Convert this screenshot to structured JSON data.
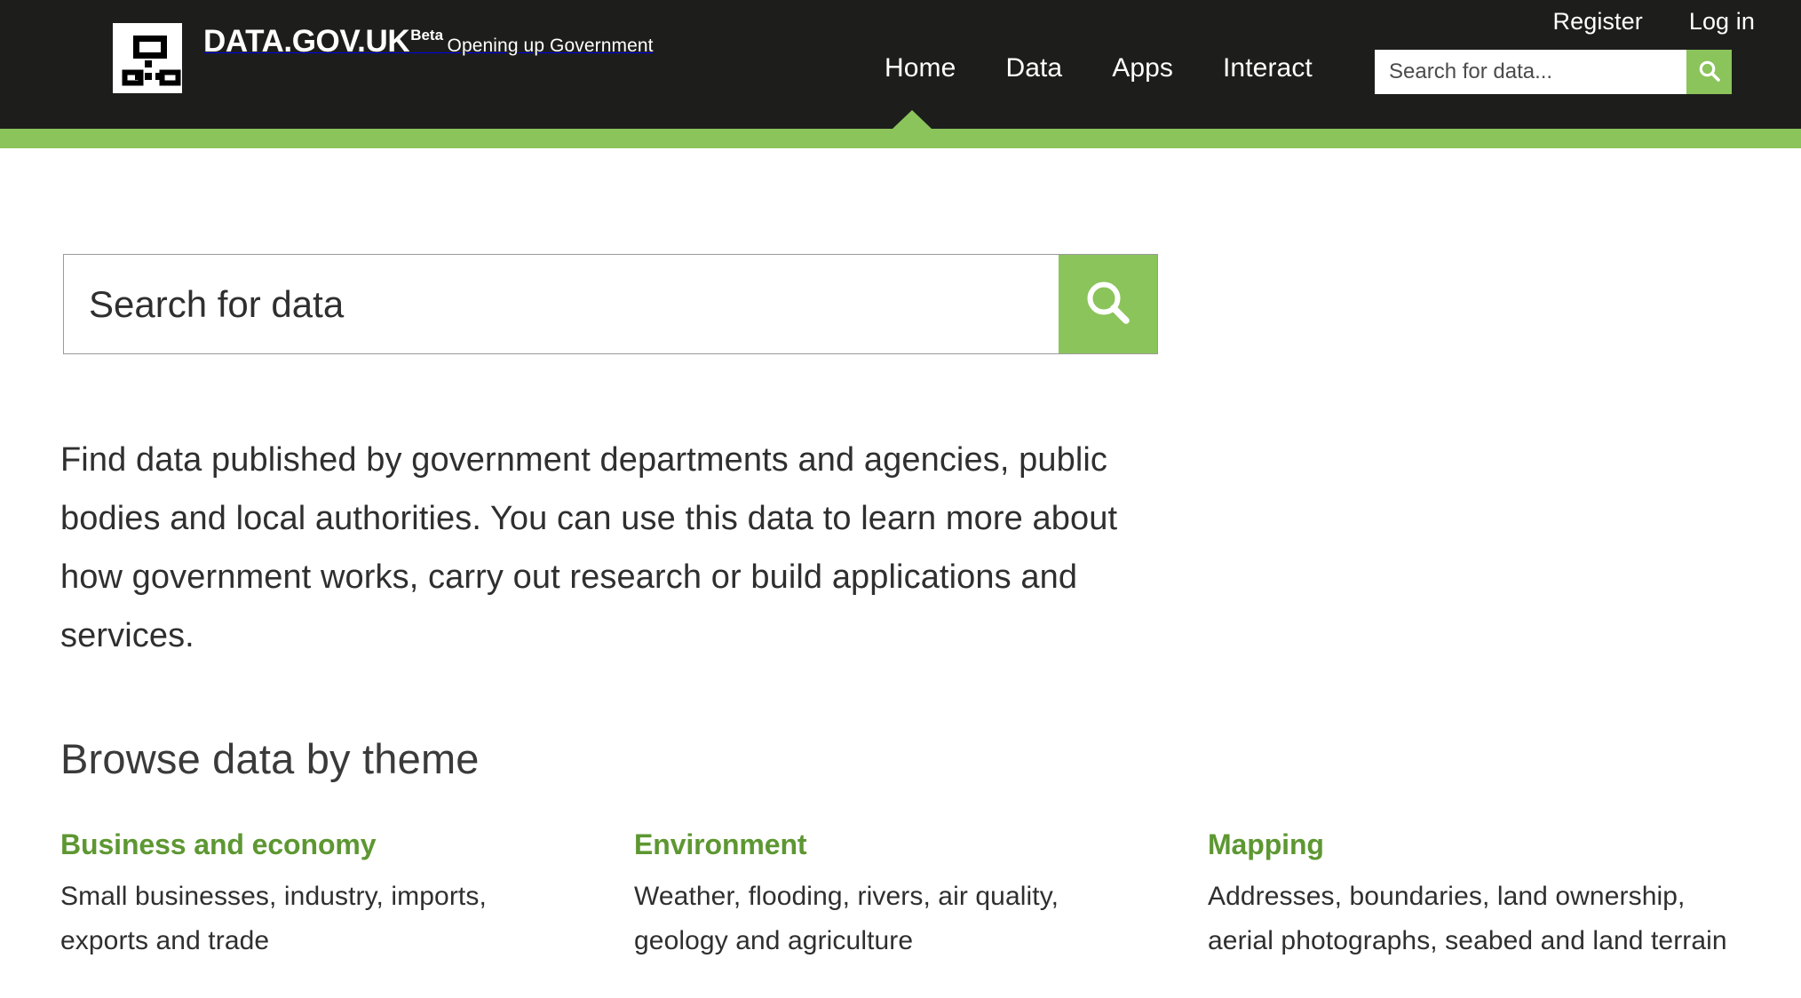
{
  "header": {
    "brand": {
      "title": "DATA.GOV.UK",
      "beta_label": "Beta",
      "tagline": "Opening up Government",
      "logo_icon": "data-grid-logo-icon"
    },
    "account_links": [
      {
        "label": "Register"
      },
      {
        "label": "Log in"
      }
    ],
    "nav": [
      {
        "label": "Home",
        "active": true
      },
      {
        "label": "Data",
        "active": false
      },
      {
        "label": "Apps",
        "active": false
      },
      {
        "label": "Interact",
        "active": false
      }
    ],
    "search": {
      "placeholder": "Search for data...",
      "value": "",
      "button_icon": "search-icon"
    },
    "colors": {
      "background": "#1d1e1c",
      "accent_green": "#8bc45a",
      "text": "#ffffff"
    }
  },
  "main": {
    "search": {
      "placeholder": "Search for data",
      "value": "",
      "button_icon": "search-icon"
    },
    "intro_paragraph": "Find data published by government departments and agencies, public bodies and local authorities. You can use this data to learn more about how government works, carry out research or build applications and services.",
    "browse_heading": "Browse data by theme",
    "themes": [
      {
        "title": "Business and economy",
        "description": "Small businesses, industry, imports, exports and trade"
      },
      {
        "title": "Environment",
        "description": "Weather, flooding, rivers, air quality, geology and agriculture"
      },
      {
        "title": "Mapping",
        "description": "Addresses, boundaries, land ownership, aerial photographs, seabed and land terrain"
      }
    ],
    "colors": {
      "link_green": "#5d9732",
      "body_text": "#2f2f2f",
      "heading_text": "#3a3a3a",
      "input_border": "#9a9a9a"
    }
  }
}
